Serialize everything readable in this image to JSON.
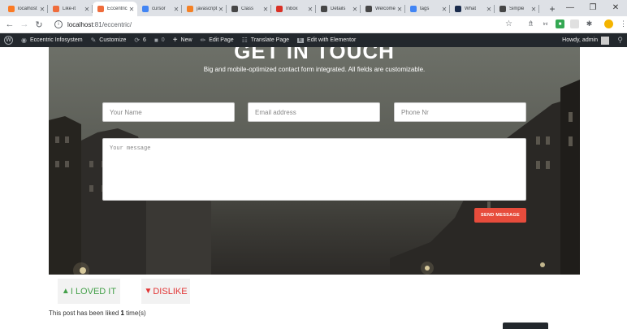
{
  "browser": {
    "tabs": [
      {
        "label": "localhost",
        "favicon": "xampp-icon",
        "color": "#fb7a24",
        "active": false
      },
      {
        "label": "Like-it",
        "favicon": "plugin-icon",
        "color": "#ef6c3b",
        "active": false
      },
      {
        "label": "Eccentric",
        "favicon": "plugin-icon",
        "color": "#ef6c3b",
        "active": true
      },
      {
        "label": "cursor",
        "favicon": "google-icon",
        "color": "#4285f4",
        "active": false
      },
      {
        "label": "javascript",
        "favicon": "stackoverflow-icon",
        "color": "#f48024",
        "active": false
      },
      {
        "label": "Class",
        "favicon": "wordpress-icon",
        "color": "#464646",
        "active": false
      },
      {
        "label": "Inbox",
        "favicon": "gmail-icon",
        "color": "#d93025",
        "active": false
      },
      {
        "label": "Details",
        "favicon": "wordpress-icon",
        "color": "#464646",
        "active": false
      },
      {
        "label": "Welcome",
        "favicon": "wordpress-icon",
        "color": "#464646",
        "active": false
      },
      {
        "label": "tags",
        "favicon": "google-icon",
        "color": "#4285f4",
        "active": false
      },
      {
        "label": "What",
        "favicon": "arrow-a-icon",
        "color": "#1a2b4c",
        "active": false
      },
      {
        "label": "Simple",
        "favicon": "wordpress-icon",
        "color": "#464646",
        "active": false
      }
    ],
    "url_host": "localhost",
    "url_path": ":81/eccentric/"
  },
  "adminbar": {
    "site_name": "Eccentric Infosystem",
    "customize": "Customize",
    "updates": "6",
    "comments": "0",
    "new": "New",
    "edit_page": "Edit Page",
    "translate": "Translate Page",
    "elementor": "Edit with Elementor",
    "howdy": "Howdy, admin"
  },
  "contact": {
    "title": "GET IN TOUCH",
    "subtitle": "Big and mobile-optimized contact form integrated. All fields are customizable.",
    "name_placeholder": "Your Name",
    "email_placeholder": "Email address",
    "phone_placeholder": "Phone Nr",
    "message_placeholder": "Your message",
    "send_label": "SEND MESSAGE"
  },
  "likes": {
    "like_label": "I LOVED IT",
    "dislike_label": "DISLIKE",
    "summary_prefix": "This post has been liked ",
    "count": "1",
    "summary_suffix": " time(s)"
  },
  "colors": {
    "accent": "#e74c3c",
    "like": "#44a04a",
    "dislike": "#e23434",
    "adminbar": "#23282d"
  }
}
